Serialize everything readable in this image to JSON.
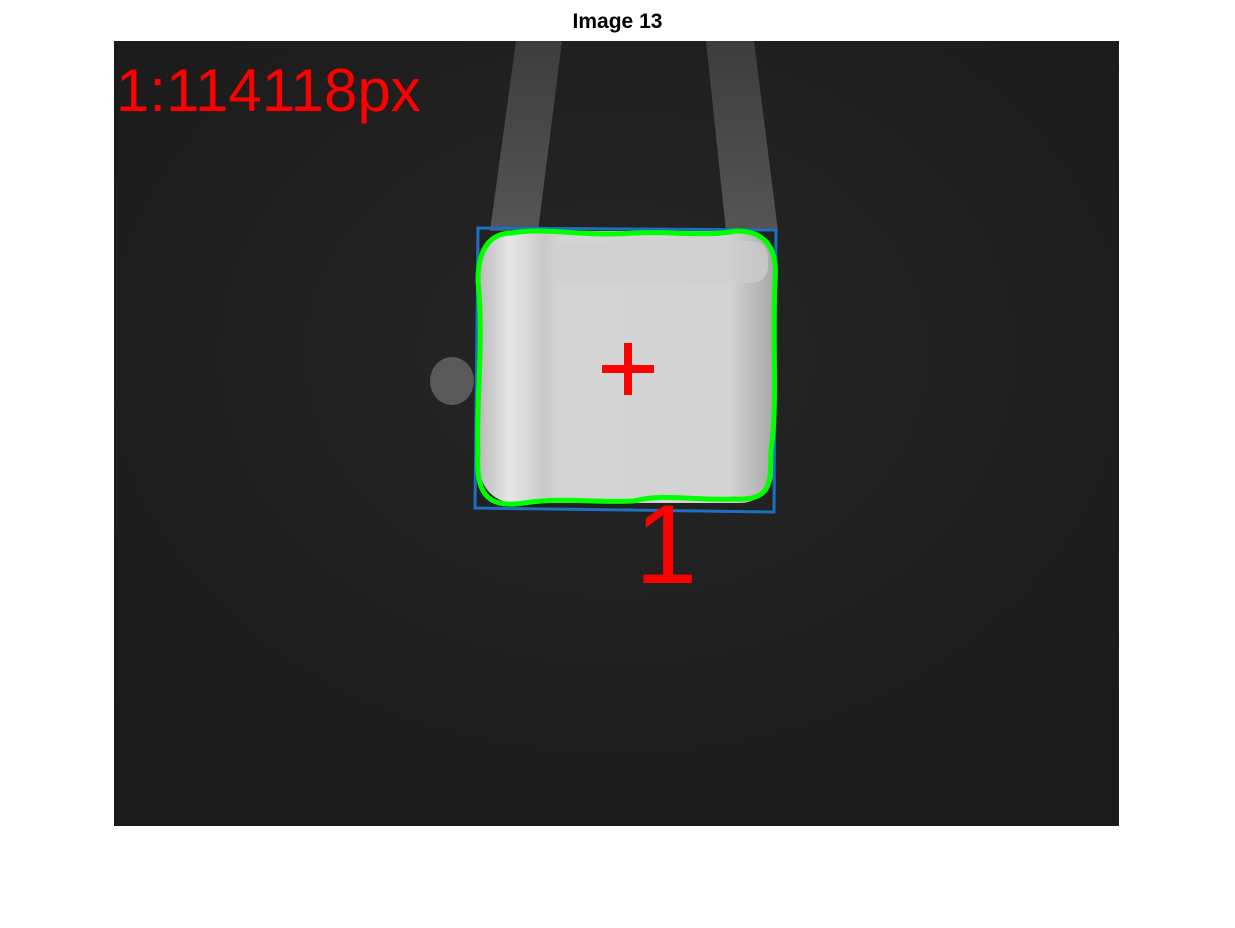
{
  "figure": {
    "title": "Image 13"
  },
  "annotations": {
    "area_label": "1:114118px",
    "object_id": "1",
    "centroid_marker": "+"
  },
  "colors": {
    "background": "#1d1d1d",
    "contour": "#00ff00",
    "bounding_box": "#1f6fbf",
    "labels": "#ff0000"
  }
}
